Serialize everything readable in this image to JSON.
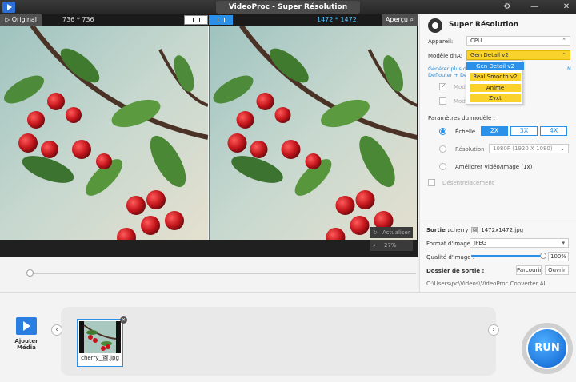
{
  "app": {
    "title": "VideoProc - Super Résolution"
  },
  "preview": {
    "original_label": "Original",
    "original_dims": "736 * 736",
    "output_dims": "1472 * 1472",
    "apercu_label": "Aperçu",
    "refresh_label": "Actualiser",
    "zoom": "27%"
  },
  "panel": {
    "title": "Super Résolution",
    "device_label": "Appareil:",
    "device_value": "CPU",
    "model_label": "Modèle d'IA:",
    "model_value": "Gen Detail v2",
    "hint_line1": "Générer plus de",
    "hint_line1_end": "N.",
    "hint_line2": "Déflouter + Débr",
    "cb1_label": "Mod",
    "cb2_label": "Mod",
    "params_label": "Paramètres du modèle :",
    "scale_label": "Échelle",
    "scales": [
      "2X",
      "3X",
      "4X"
    ],
    "resolution_label": "Résolution",
    "resolution_value": "1080P (1920 X 1080)",
    "improve_label": "Améliorer Vidéo/Image (1x)",
    "deinterlace_label": "Désentrelacement",
    "output_label": "Sortie :",
    "output_value": "cherry_🖼_1472x1472.jpg",
    "format_label": "Format d'image :",
    "format_value": "JPEG",
    "quality_label": "Qualité d'image :",
    "quality_value": "100%",
    "folder_label": "Dossier de sortie :",
    "browse_label": "Parcourir",
    "open_label": "Ouvrir",
    "folder_path": "C:\\Users\\pc\\Videos\\VideoProc Converter AI"
  },
  "dropdown": {
    "items": [
      "Gen Detail v2",
      "Real Smooth v2",
      "Anime",
      "Zyxt"
    ]
  },
  "bottom": {
    "add_media_label": "Ajouter Média",
    "thumb_label": "cherry_🖼.jpg",
    "run_label": "RUN"
  },
  "colors": {
    "accent": "#2a90e8",
    "model_yellow": "#f9d22b",
    "hint_blue": "#2a8fd8"
  },
  "icons": {
    "title_buttons": [
      "gear-icon",
      "minimize-icon",
      "close-icon"
    ]
  }
}
